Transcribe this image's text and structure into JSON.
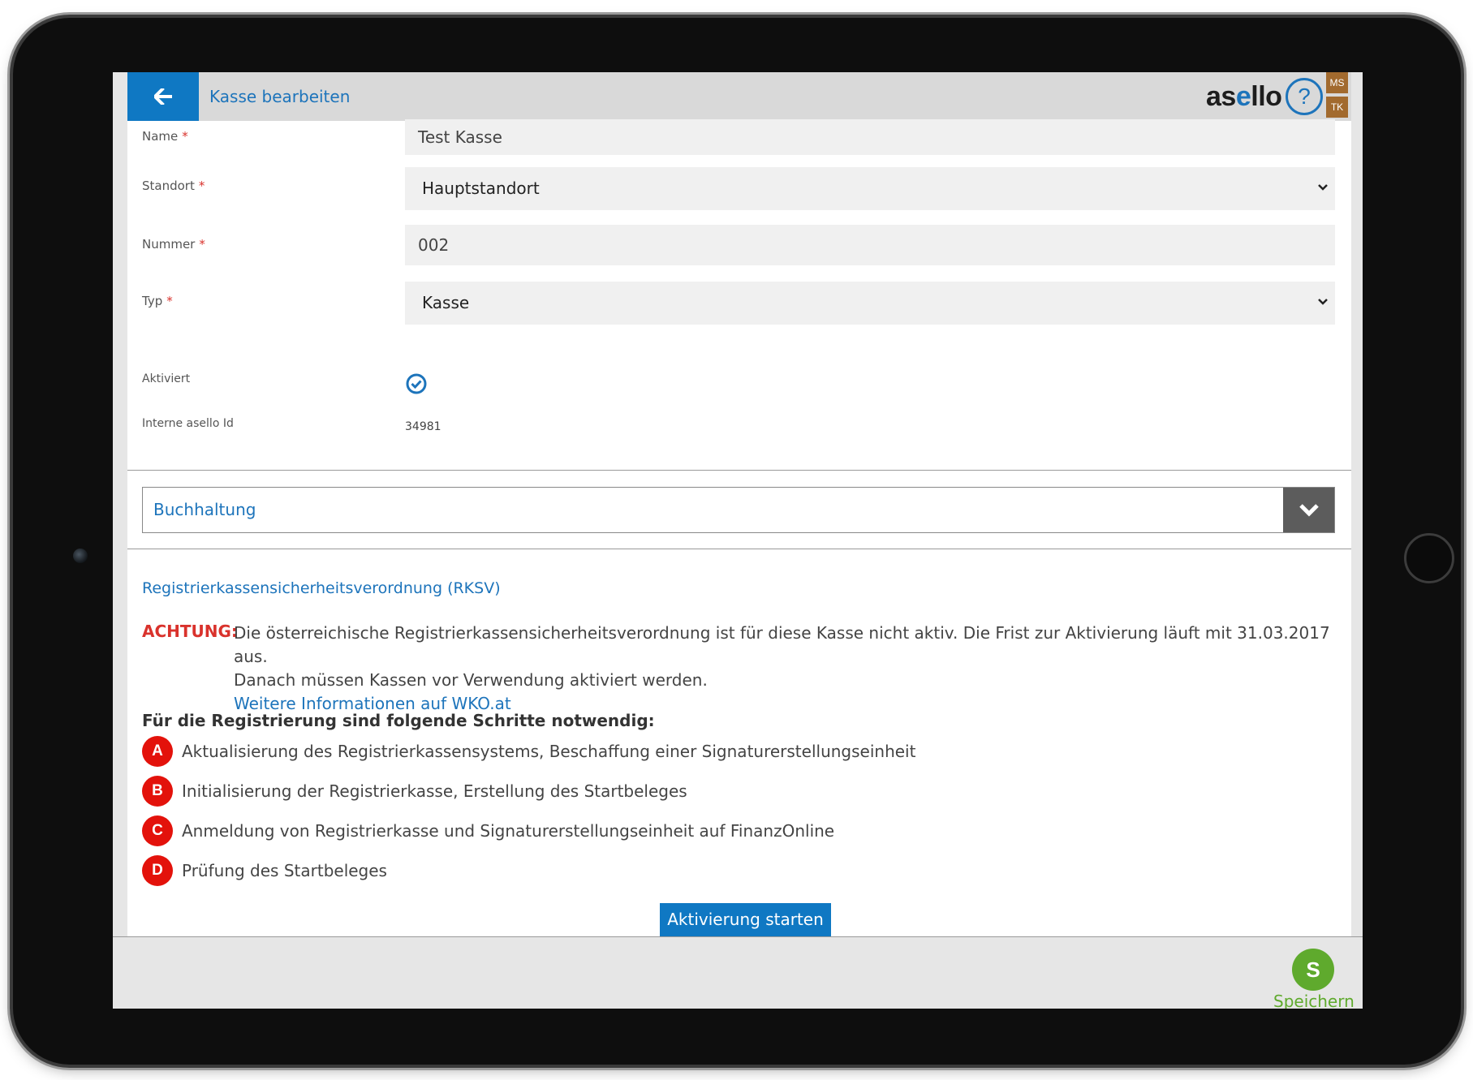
{
  "header": {
    "title": "Kasse bearbeiten",
    "logo_prefix": "as",
    "logo_accent": "e",
    "logo_suffix": "llo",
    "help_glyph": "?",
    "user_badges": [
      "MS",
      "TK"
    ]
  },
  "form": {
    "name": {
      "label": "Name",
      "required_mark": "*",
      "value": "Test Kasse"
    },
    "standort": {
      "label": "Standort",
      "required_mark": "*",
      "value": "Hauptstandort"
    },
    "nummer": {
      "label": "Nummer",
      "required_mark": "*",
      "value": "002"
    },
    "typ": {
      "label": "Typ",
      "required_mark": "*",
      "value": "Kasse"
    },
    "aktiviert": {
      "label": "Aktiviert",
      "checked": true
    },
    "interne_id": {
      "label": "Interne asello Id",
      "value": "34981"
    }
  },
  "accordion": {
    "label": "Buchhaltung",
    "expanded": false
  },
  "rksv": {
    "title": "Registrierkassensicherheitsverordnung (RKSV)",
    "warning_label": "ACHTUNG:",
    "warning_line1": "Die österreichische Registrierkassensicherheitsverordnung ist für diese Kasse nicht aktiv. Die Frist zur Aktivierung läuft mit 31.03.2017 aus.",
    "warning_line2": "Danach müssen Kassen vor Verwendung aktiviert werden.",
    "info_link": "Weitere Informationen auf WKO.at",
    "steps_heading": "Für die Registrierung sind folgende Schritte notwendig:",
    "steps": [
      {
        "letter": "A",
        "text": "Aktualisierung des Registrierkassensystems, Beschaffung einer Signaturerstellungseinheit"
      },
      {
        "letter": "B",
        "text": "Initialisierung der Registrierkasse, Erstellung des Startbeleges"
      },
      {
        "letter": "C",
        "text": "Anmeldung von Registrierkasse und Signaturerstellungseinheit auf FinanzOnline"
      },
      {
        "letter": "D",
        "text": "Prüfung des Startbeleges"
      }
    ],
    "activate_button": "Aktivierung starten"
  },
  "footer": {
    "save_letter": "S",
    "save_label": "Speichern"
  },
  "colors": {
    "primary": "#0f78c3",
    "required": "#d9322c",
    "step_red": "#e3120b",
    "save_green": "#5faa2d",
    "badge_brown": "#a26a2e"
  },
  "icons": {
    "back": "arrow-left-icon",
    "help": "question-circle-icon",
    "select": "chevron-down-icon",
    "check": "check-circle-icon",
    "accordion": "chevron-down-icon"
  }
}
